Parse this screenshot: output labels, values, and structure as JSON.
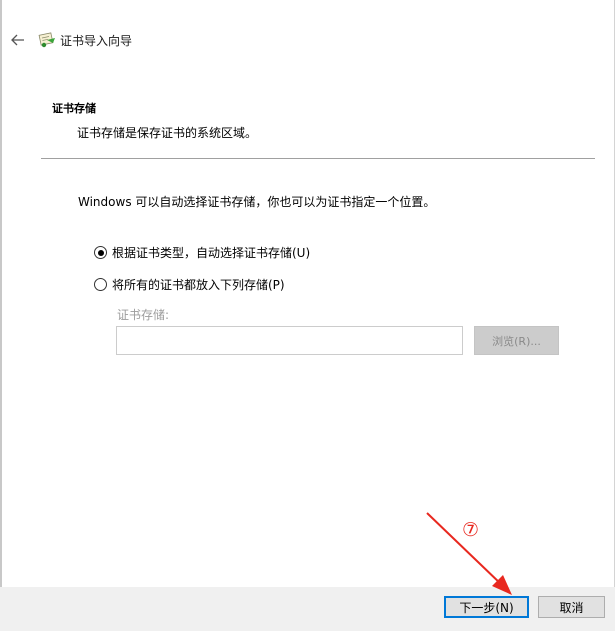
{
  "window": {
    "title": "证书导入向导",
    "back_icon": "back-arrow-icon",
    "app_icon": "certificate-icon"
  },
  "section": {
    "heading": "证书存储",
    "description": "证书存储是保存证书的系统区域。"
  },
  "intro": "Windows 可以自动选择证书存储，你也可以为证书指定一个位置。",
  "options": [
    {
      "label": "根据证书类型，自动选择证书存储(U)",
      "selected": true
    },
    {
      "label": "将所有的证书都放入下列存储(P)",
      "selected": false
    }
  ],
  "store": {
    "label": "证书存储:",
    "value": "",
    "browse_label": "浏览(R)..."
  },
  "footer": {
    "next_label": "下一步(N)",
    "cancel_label": "取消"
  },
  "annotation": {
    "step_marker": "⑦",
    "color": "#e8281f"
  },
  "colors": {
    "accent": "#0078d7",
    "footer_bg": "#f0f0f0",
    "disabled_text": "#9c9c9c"
  }
}
